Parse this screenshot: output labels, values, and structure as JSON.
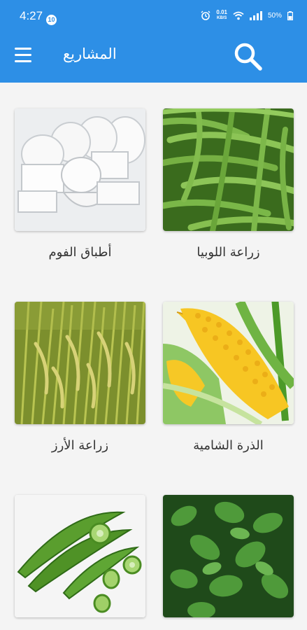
{
  "status_bar": {
    "time": "4:27",
    "notification_count": "10",
    "net_speed_value": "0.01",
    "net_speed_unit": "KB/S",
    "battery": "50%"
  },
  "app_bar": {
    "title": "المشاريع",
    "menu_icon": "hamburger-menu-icon",
    "search_icon": "search-icon",
    "color": "#2d8fe6"
  },
  "projects": [
    {
      "label": "زراعة اللوبيا",
      "image": "green-beans-photo"
    },
    {
      "label": "أطباق الفوم",
      "image": "foam-plates-photo"
    },
    {
      "label": "الذرة الشامية",
      "image": "corn-photo"
    },
    {
      "label": "زراعة الأرز",
      "image": "rice-field-photo"
    },
    {
      "label": "",
      "image": "leafy-plant-photo"
    },
    {
      "label": "",
      "image": "okra-photo"
    }
  ]
}
